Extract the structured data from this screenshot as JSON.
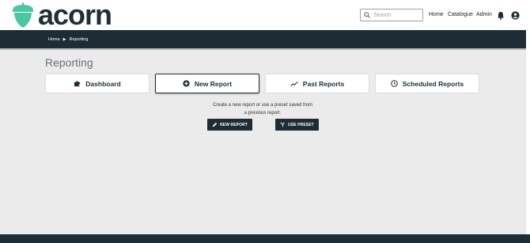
{
  "header": {
    "brand": "acorn",
    "search_placeholder": "Search",
    "nav": [
      "Home",
      "Catalogue",
      "Admin"
    ],
    "icons": [
      "bell-icon",
      "account-circle-icon"
    ],
    "brand_color": "#4cc8a0"
  },
  "breadcrumb": {
    "items": [
      "Home",
      "Reporting"
    ]
  },
  "page": {
    "title": "Reporting"
  },
  "tabs": [
    {
      "label": "Dashboard",
      "icon": "puzzle-icon",
      "active": false
    },
    {
      "label": "New Report",
      "icon": "plus-circle-icon",
      "active": true
    },
    {
      "label": "Past Reports",
      "icon": "trend-icon",
      "active": false
    },
    {
      "label": "Scheduled Reports",
      "icon": "clock-icon",
      "active": false
    }
  ],
  "new_report": {
    "description_line1": "Create a new report or use a preset saved from",
    "description_line2": "a previous report.",
    "new_report_button": "NEW REPORT",
    "use_preset_button": "USE PRESET"
  },
  "colors": {
    "dark": "#1e2d35",
    "background": "#ebebeb"
  }
}
